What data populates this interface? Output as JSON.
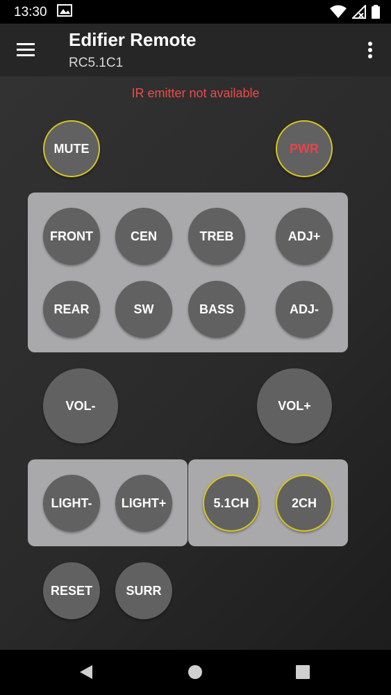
{
  "status": {
    "time": "13:30",
    "icons": [
      "notification-image-icon",
      "wifi-icon",
      "signal-icon",
      "battery-icon"
    ]
  },
  "app_bar": {
    "title": "Edifier Remote",
    "subtitle": "RC5.1C1",
    "menu_icon": "hamburger-menu-icon",
    "overflow_icon": "overflow-menu-icon"
  },
  "warning": "IR emitter not available",
  "buttons": {
    "mute": "MUTE",
    "pwr": "PWR",
    "front": "FRONT",
    "cen": "CEN",
    "treb": "TREB",
    "adj_plus": "ADJ+",
    "rear": "REAR",
    "sw": "SW",
    "bass": "BASS",
    "adj_minus": "ADJ-",
    "vol_minus": "VOL-",
    "vol_plus": "VOL+",
    "light_minus": "LIGHT-",
    "light_plus": "LIGHT+",
    "ch51": "5.1CH",
    "ch2": "2CH",
    "reset": "RESET",
    "surr": "SURR"
  },
  "colors": {
    "warning_red": "#ee4a4a",
    "accent_yellow": "#d9c520",
    "button_gray": "#616161",
    "panel_gray": "#a9a9ab"
  },
  "nav": {
    "back_icon": "back-triangle-icon",
    "home_icon": "home-circle-icon",
    "recents_icon": "recents-square-icon"
  }
}
